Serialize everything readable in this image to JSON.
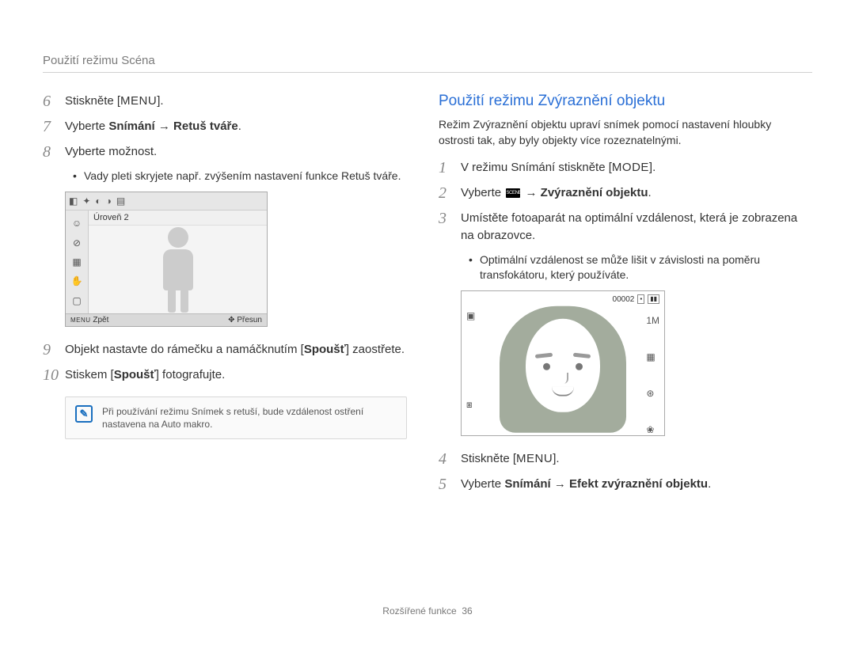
{
  "header": "Použití režimu Scéna",
  "left": {
    "step6_pre": "Stiskněte [",
    "step6_menu": "MENU",
    "step6_post": "].",
    "step7": "Vyberte <b>Snímání</b> → <b>Retuš tváře</b>.",
    "step8": "Vyberte možnost.",
    "bullet8": "Vady pleti skryjete např. zvýšením nastavení funkce Retuš tváře.",
    "step9": "Objekt nastavte do rámečku a namáčknutím [<b>Spoušť</b>] zaostřete.",
    "step10": "Stiskem [<b>Spoušť</b>] fotografujte.",
    "note": "Při používání režimu Snímek s retuší, bude vzdálenost ostření nastavena na Auto makro."
  },
  "right": {
    "title": "Použití režimu Zvýraznění objektu",
    "intro": "Režim Zvýraznění objektu upraví snímek pomocí nastavení hloubky ostrosti tak, aby byly objekty více rozeznatelnými.",
    "step1_pre": "V režimu Snímání stiskněte [",
    "step1_mode": "MODE",
    "step1_post": "].",
    "step2_pre": "Vyberte ",
    "step2_post": " → <b>Zvýraznění objektu</b>.",
    "step3": "Umístěte fotoaparát na optimální vzdálenost, která je zobrazena na obrazovce.",
    "bullet3": "Optimální vzdálenost se může lišit v závislosti na poměru transfokátoru, který používáte.",
    "step4_pre": "Stiskněte [",
    "step4_menu": "MENU",
    "step4_post": "].",
    "step5": "Vyberte <b>Snímání</b> → <b>Efekt zvýraznění objektu</b>."
  },
  "lcd": {
    "level": "Úroveň 2",
    "back_lbl": "Zpět",
    "move_lbl": "Přesun",
    "menu_word": "MENU"
  },
  "lcd2": {
    "counter": "00002",
    "icons_left_a": "▣",
    "icons_left_b": "⧆",
    "icons_right_a": "1M",
    "icons_right_b": "▦",
    "icons_right_c": "⊛",
    "icons_right_d": "❀"
  },
  "footer": {
    "section": "Rozšířené funkce",
    "page": "36"
  },
  "step_numbers": {
    "n6": "6",
    "n7": "7",
    "n8": "8",
    "n9": "9",
    "n10": "10",
    "r1": "1",
    "r2": "2",
    "r3": "3",
    "r4": "4",
    "r5": "5"
  }
}
